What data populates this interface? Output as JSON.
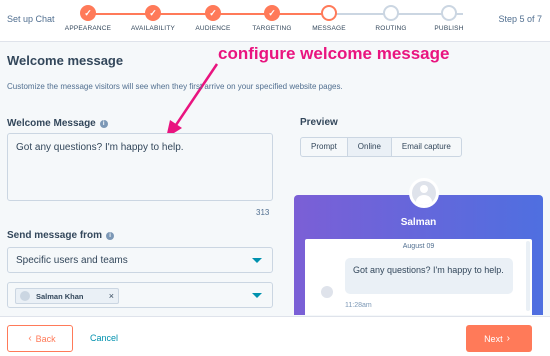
{
  "header": {
    "setup_title": "Set up Chat",
    "step_count": "Step 5 of 7",
    "steps": [
      {
        "label": "APPEARANCE",
        "status": "done"
      },
      {
        "label": "AVAILABILITY",
        "status": "done"
      },
      {
        "label": "AUDIENCE",
        "status": "done"
      },
      {
        "label": "TARGETING",
        "status": "done"
      },
      {
        "label": "MESSAGE",
        "status": "current"
      },
      {
        "label": "ROUTING",
        "status": "todo"
      },
      {
        "label": "PUBLISH",
        "status": "todo"
      }
    ],
    "check_glyph": "✓"
  },
  "main": {
    "title": "Welcome message",
    "description": "Customize the message visitors will see when they first arrive on your specified website pages.",
    "annotation": "configure welcome message",
    "welcome_message": {
      "label": "Welcome Message",
      "value": "Got any questions? I'm happy to help.",
      "char_count": "313"
    },
    "send_from": {
      "label": "Send message from",
      "selected": "Specific users and teams",
      "chip_name": "Salman Khan",
      "chip_remove": "×"
    },
    "info_glyph": "i"
  },
  "preview": {
    "label": "Preview",
    "tabs": [
      "Prompt",
      "Online",
      "Email capture"
    ],
    "active_tab": "Online",
    "agent_name": "Salman",
    "date": "August 09",
    "message": "Got any questions? I'm happy to help.",
    "time": "11:28am"
  },
  "footer": {
    "back_label": "Back",
    "cancel_label": "Cancel",
    "next_label": "Next",
    "back_arrow": "‹",
    "next_arrow": "›"
  },
  "colors": {
    "accent": "#ff7a59",
    "annotation": "#e9147f",
    "link": "#0091ae",
    "widget_gradient_start": "#7b5fd6",
    "widget_gradient_end": "#4f6fe0"
  }
}
